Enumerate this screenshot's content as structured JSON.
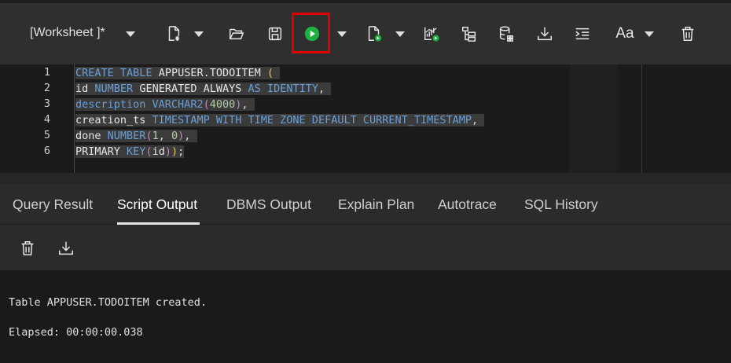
{
  "toolbar": {
    "worksheet_title": "[Worksheet ]*",
    "icons": [
      "new-worksheet-icon",
      "open-icon",
      "save-icon",
      "run-statement-icon",
      "run-script-icon",
      "explain-plan-icon",
      "autotrace-icon",
      "data-loading-icon",
      "download-icon",
      "format-icon",
      "font-size-icon",
      "clear-icon"
    ],
    "font_size_label": "Aa",
    "run_color": "#1fb043",
    "highlight_color": "#e00000"
  },
  "editor": {
    "lines": [
      {
        "n": "1",
        "text": "CREATE TABLE APPUSER.TODOITEM ("
      },
      {
        "n": "2",
        "text": "id NUMBER GENERATED ALWAYS AS IDENTITY,"
      },
      {
        "n": "3",
        "text": "description VARCHAR2(4000),"
      },
      {
        "n": "4",
        "text": "creation_ts TIMESTAMP WITH TIME ZONE DEFAULT CURRENT_TIMESTAMP,"
      },
      {
        "n": "5",
        "text": "done NUMBER(1, 0),"
      },
      {
        "n": "6",
        "text": "PRIMARY KEY(id));"
      }
    ]
  },
  "tabs": [
    {
      "label": "Query Result",
      "active": false
    },
    {
      "label": "Script Output",
      "active": true
    },
    {
      "label": "DBMS Output",
      "active": false
    },
    {
      "label": "Explain Plan",
      "active": false
    },
    {
      "label": "Autotrace",
      "active": false
    },
    {
      "label": "SQL History",
      "active": false
    }
  ],
  "output_toolbar": {
    "icons": [
      "trash-icon",
      "download-icon"
    ]
  },
  "output": {
    "line1": "Table APPUSER.TODOITEM created.",
    "line2": "Elapsed: 00:00:00.038"
  }
}
